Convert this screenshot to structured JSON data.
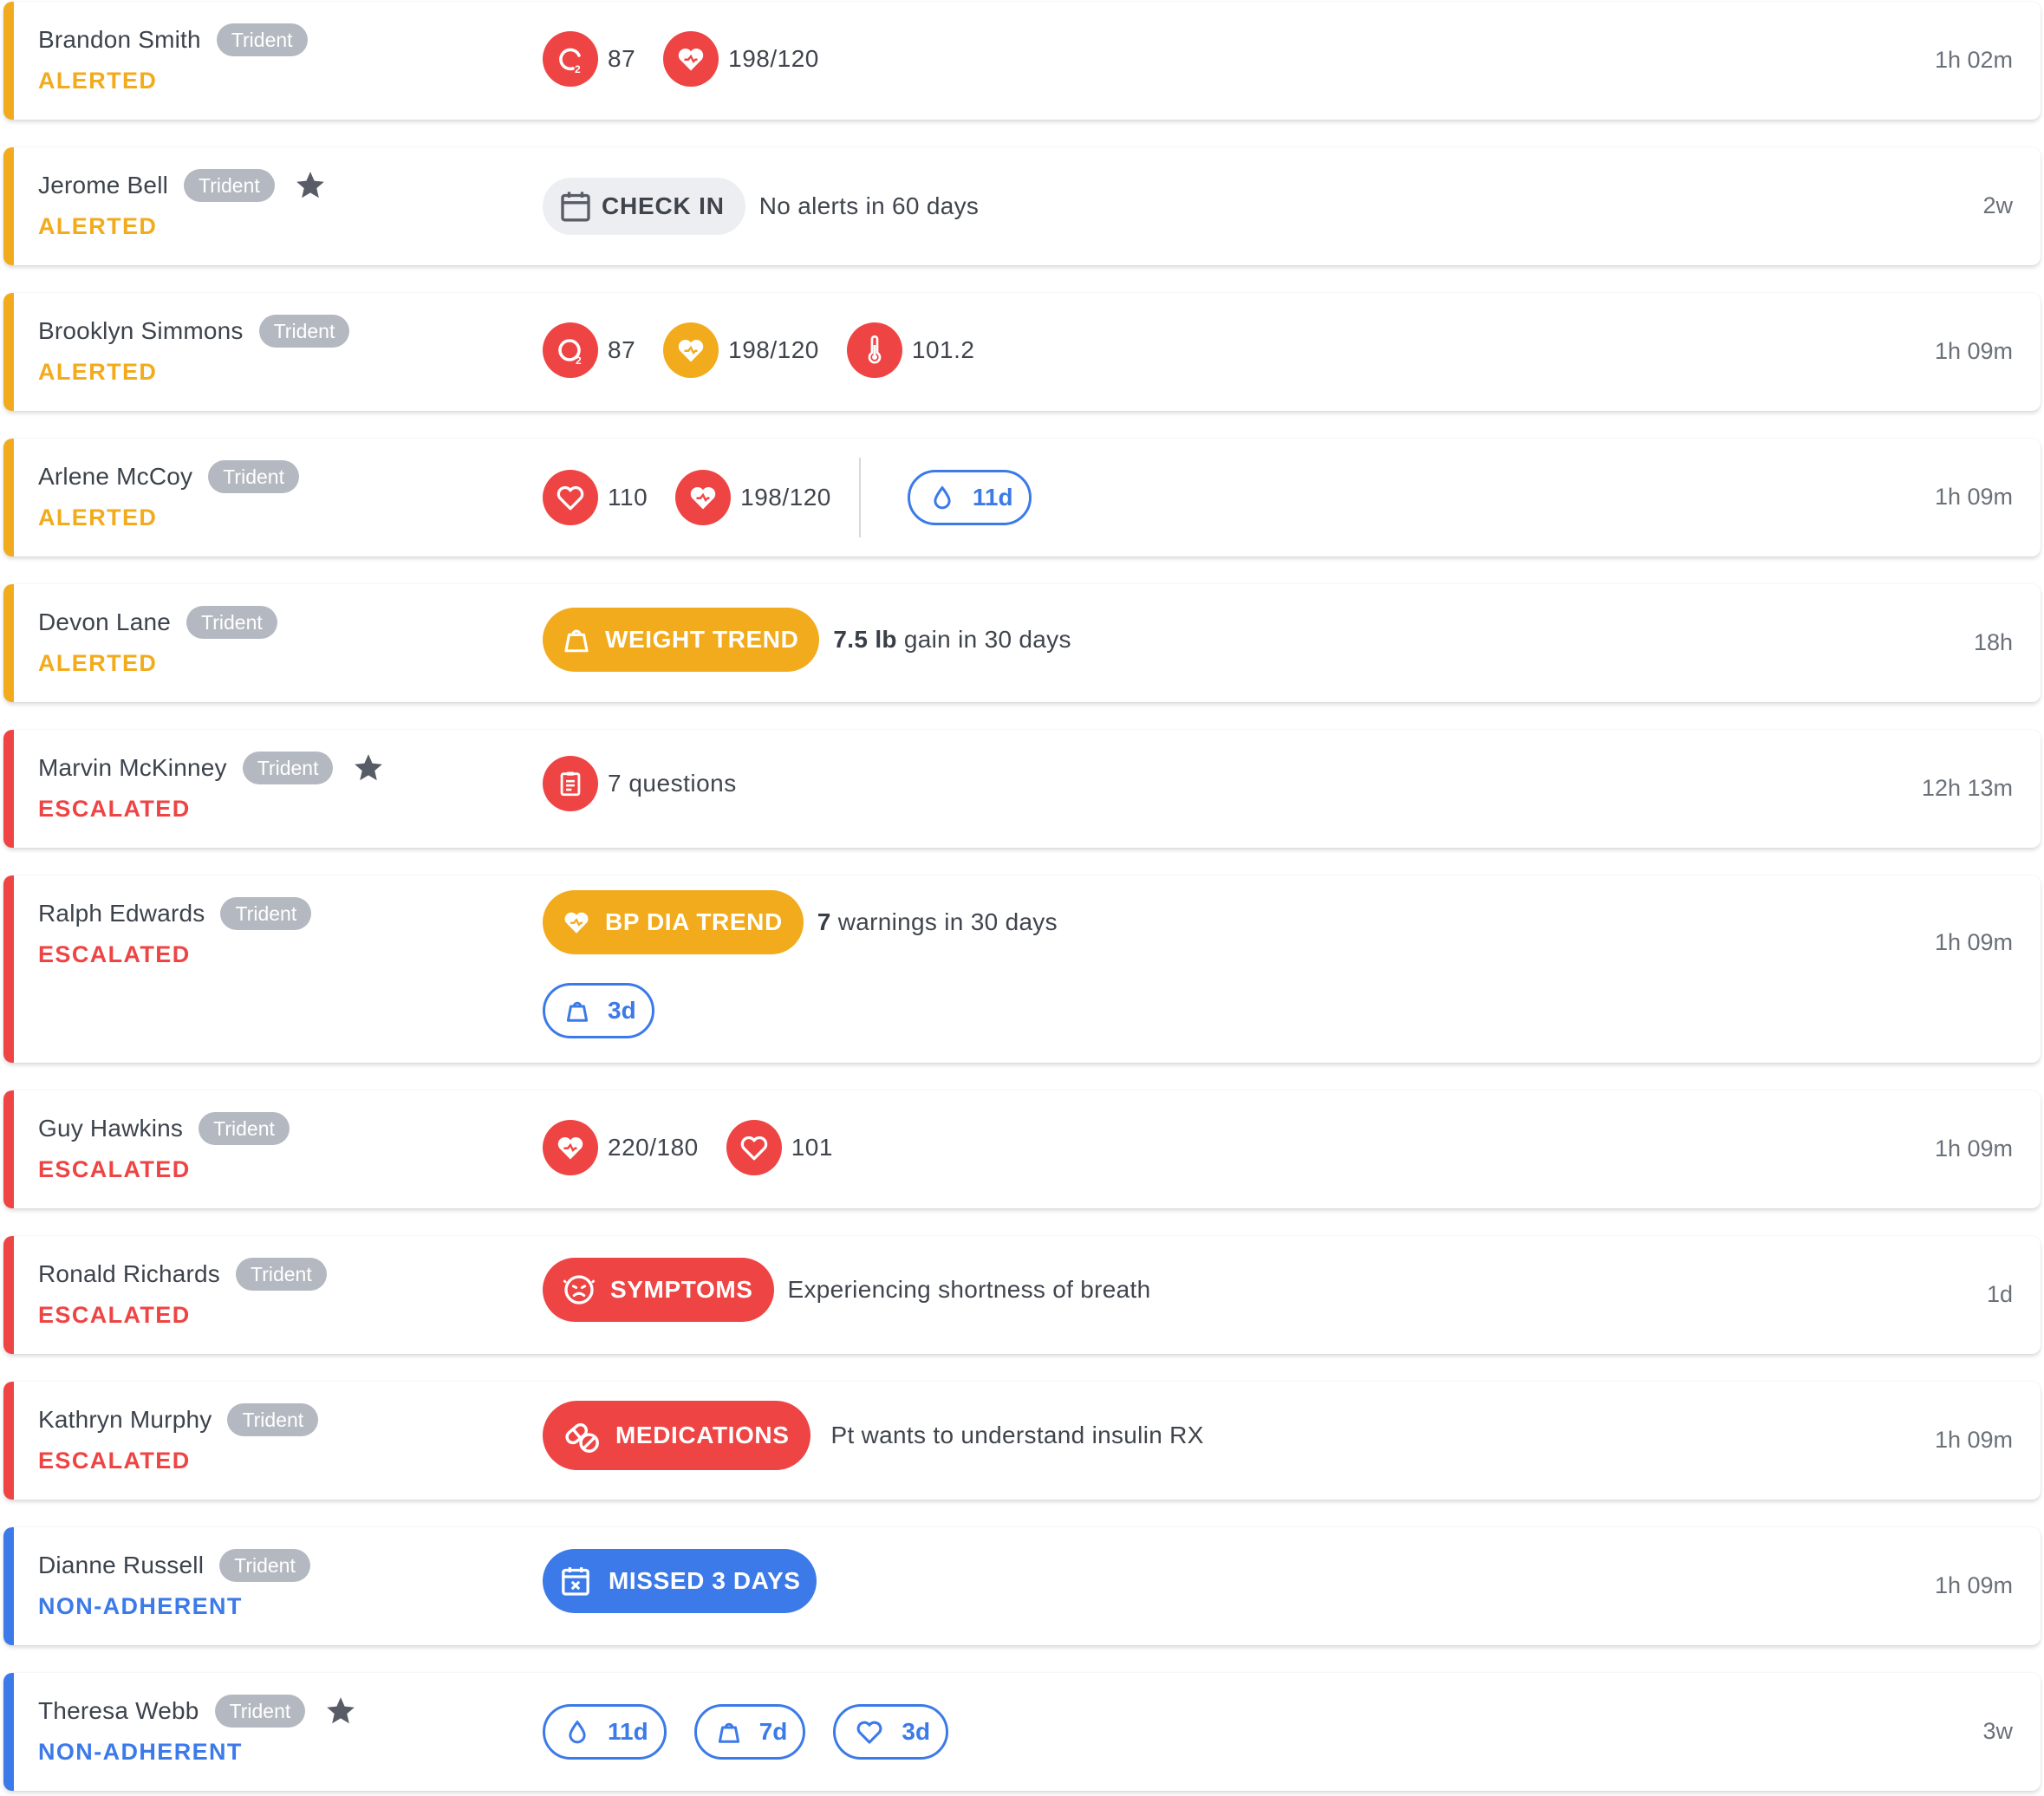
{
  "colors": {
    "alerted": "#f2ab1c",
    "escalated": "#ef4444",
    "non_adherent": "#3b7ae8",
    "tag": "#b4b9c1"
  },
  "patients": [
    {
      "name": "Brandon Smith",
      "tag": "Trident",
      "status": "ALERTED",
      "time": "1h 02m",
      "vitals": [
        {
          "icon": "oxygen-icon",
          "value": "87"
        },
        {
          "icon": "heart-icon",
          "value": "198/120"
        }
      ]
    },
    {
      "name": "Jerome Bell",
      "tag": "Trident",
      "status": "ALERTED",
      "time": "2w",
      "starred": true,
      "pill": {
        "icon": "calendar-icon",
        "label": "CHECK IN"
      },
      "desc": "No alerts in 60 days"
    },
    {
      "name": "Brooklyn Simmons",
      "tag": "Trident",
      "status": "ALERTED",
      "time": "1h 09m",
      "vitals": [
        {
          "icon": "oxygen-icon",
          "value": "87"
        },
        {
          "icon": "heart-icon",
          "value": "198/120"
        },
        {
          "icon": "thermometer-icon",
          "value": "101.2"
        }
      ]
    },
    {
      "name": "Arlene McCoy",
      "tag": "Trident",
      "status": "ALERTED",
      "time": "1h 09m",
      "vitals": [
        {
          "icon": "heart-outline-icon",
          "value": "110"
        },
        {
          "icon": "heart-icon",
          "value": "198/120"
        }
      ],
      "overdue": [
        {
          "icon": "drop-icon",
          "label": "11d"
        }
      ]
    },
    {
      "name": "Devon Lane",
      "tag": "Trident",
      "status": "ALERTED",
      "time": "18h",
      "pill": {
        "icon": "weight-icon",
        "label": "WEIGHT TREND"
      },
      "desc_bold": "7.5 lb",
      "desc": " gain in 30 days"
    },
    {
      "name": "Marvin McKinney",
      "tag": "Trident",
      "status": "ESCALATED",
      "time": "12h 13m",
      "starred": true,
      "vitals": [
        {
          "icon": "clipboard-icon",
          "value": "7 questions"
        }
      ]
    },
    {
      "name": "Ralph Edwards",
      "tag": "Trident",
      "status": "ESCALATED",
      "time": "1h 09m",
      "pill": {
        "icon": "heart-icon",
        "label": "BP DIA TREND"
      },
      "desc_bold": "7",
      "desc": " warnings in 30 days",
      "overdue": [
        {
          "icon": "weight-icon",
          "label": "3d"
        }
      ]
    },
    {
      "name": "Guy Hawkins",
      "tag": "Trident",
      "status": "ESCALATED",
      "time": "1h 09m",
      "vitals": [
        {
          "icon": "heart-icon",
          "value": "220/180"
        },
        {
          "icon": "heart-outline-icon",
          "value": "101"
        }
      ]
    },
    {
      "name": "Ronald Richards",
      "tag": "Trident",
      "status": "ESCALATED",
      "time": "1d",
      "pill": {
        "icon": "symptoms-icon",
        "label": "SYMPTOMS"
      },
      "desc": "Experiencing shortness of breath"
    },
    {
      "name": "Kathryn Murphy",
      "tag": "Trident",
      "status": "ESCALATED",
      "time": "1h 09m",
      "pill": {
        "icon": "pill-icon",
        "label": "MEDICATIONS"
      },
      "desc": "Pt wants to understand insulin RX"
    },
    {
      "name": "Dianne Russell",
      "tag": "Trident",
      "status": "NON-ADHERENT",
      "time": "1h 09m",
      "pill": {
        "icon": "calendar-x-icon",
        "label": "MISSED 3 DAYS"
      }
    },
    {
      "name": "Theresa Webb",
      "tag": "Trident",
      "status": "NON-ADHERENT",
      "time": "3w",
      "starred": true,
      "overdue": [
        {
          "icon": "drop-icon",
          "label": "11d"
        },
        {
          "icon": "weight-icon",
          "label": "7d"
        },
        {
          "icon": "heart-outline-icon",
          "label": "3d"
        }
      ]
    }
  ]
}
